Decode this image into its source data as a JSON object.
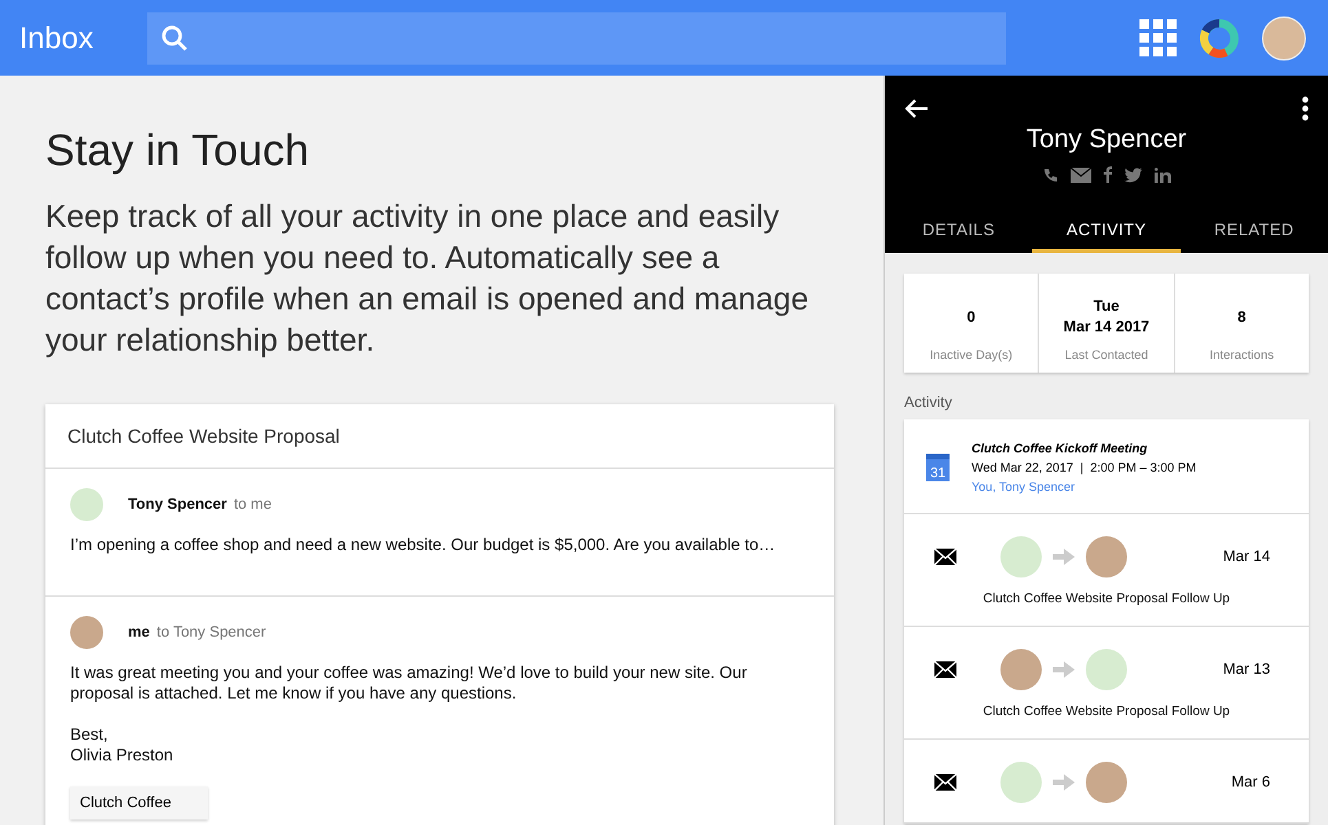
{
  "app_bar": {
    "title": "Inbox"
  },
  "hero": {
    "title": "Stay in Touch",
    "text": "Keep track of all your activity in one place and easily follow up when you need to. Automatically see a contact’s profile when an email is opened and manage your relationship better."
  },
  "thread": {
    "subject": "Clutch Coffee Website Proposal",
    "messages": [
      {
        "sender": "Tony Spencer",
        "recipient": "to me",
        "body": [
          "I’m opening a coffee shop and need a new website. Our budget is $5,000. Are you available to…"
        ]
      },
      {
        "sender": "me",
        "recipient": "to Tony Spencer",
        "body": [
          "It was great meeting you and your coffee was amazing! We’d love to build your new site. Our proposal is attached. Let me know if you have any questions.",
          "Best,\nOlivia Preston"
        ],
        "attachment": "Clutch Coffee"
      }
    ]
  },
  "contact": {
    "name": "Tony Spencer",
    "tabs": [
      {
        "label": "DETAILS",
        "selected": false
      },
      {
        "label": "ACTIVITY",
        "selected": true
      },
      {
        "label": "RELATED",
        "selected": false
      }
    ],
    "stats": [
      {
        "value": "0",
        "label": "Inactive Day(s)"
      },
      {
        "value": "Tue\nMar 14 2017",
        "label": "Last Contacted"
      },
      {
        "value": "8",
        "label": "Interactions"
      }
    ],
    "activity_heading": "Activity",
    "activity": [
      {
        "kind": "event",
        "title": "Clutch Coffee Kickoff Meeting",
        "when": "Wed Mar 22, 2017  |  2:00 PM – 3:00 PM",
        "people": "You, Tony Spencer",
        "day": "31"
      },
      {
        "kind": "email",
        "date": "Mar 14",
        "subject": "Clutch Coffee Website Proposal Follow Up"
      },
      {
        "kind": "email",
        "date": "Mar 13",
        "subject": "Clutch Coffee Website Proposal Follow Up"
      },
      {
        "kind": "email",
        "date": "Mar 6"
      }
    ]
  }
}
